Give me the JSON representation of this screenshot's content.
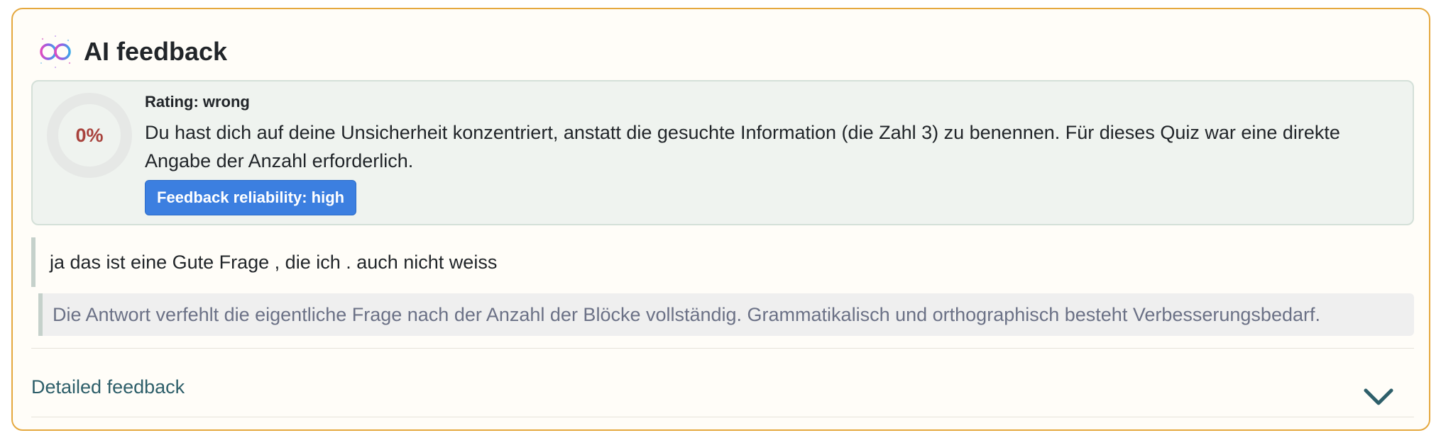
{
  "header": {
    "title": "AI feedback",
    "logo_icon": "infinity-logo-icon"
  },
  "rating": {
    "percent_label": "0%",
    "percent_value": 0,
    "label": "Rating: wrong",
    "text": "Du hast dich auf deine Unsicherheit konzentriert, anstatt die gesuchte Information (die Zahl 3) zu benennen. Für dieses Quiz war eine direkte Angabe der Anzahl erforderlich.",
    "reliability_badge": "Feedback reliability: high"
  },
  "answer": {
    "text": "ja das ist eine Gute Frage , die ich . auch nicht weiss"
  },
  "summary": {
    "text": "Die Antwort verfehlt die eigentliche Frage nach der Anzahl der Blöcke vollständig. Grammatikalisch und orthographisch besteht Verbesserungsbedarf."
  },
  "details": {
    "label": "Detailed feedback",
    "toggle_icon": "chevron-down-icon"
  },
  "colors": {
    "card_border": "#e5a83e",
    "rating_wrong": "#a8423c",
    "badge_blue": "#3c7fe0",
    "link_teal": "#2e5f6a"
  }
}
